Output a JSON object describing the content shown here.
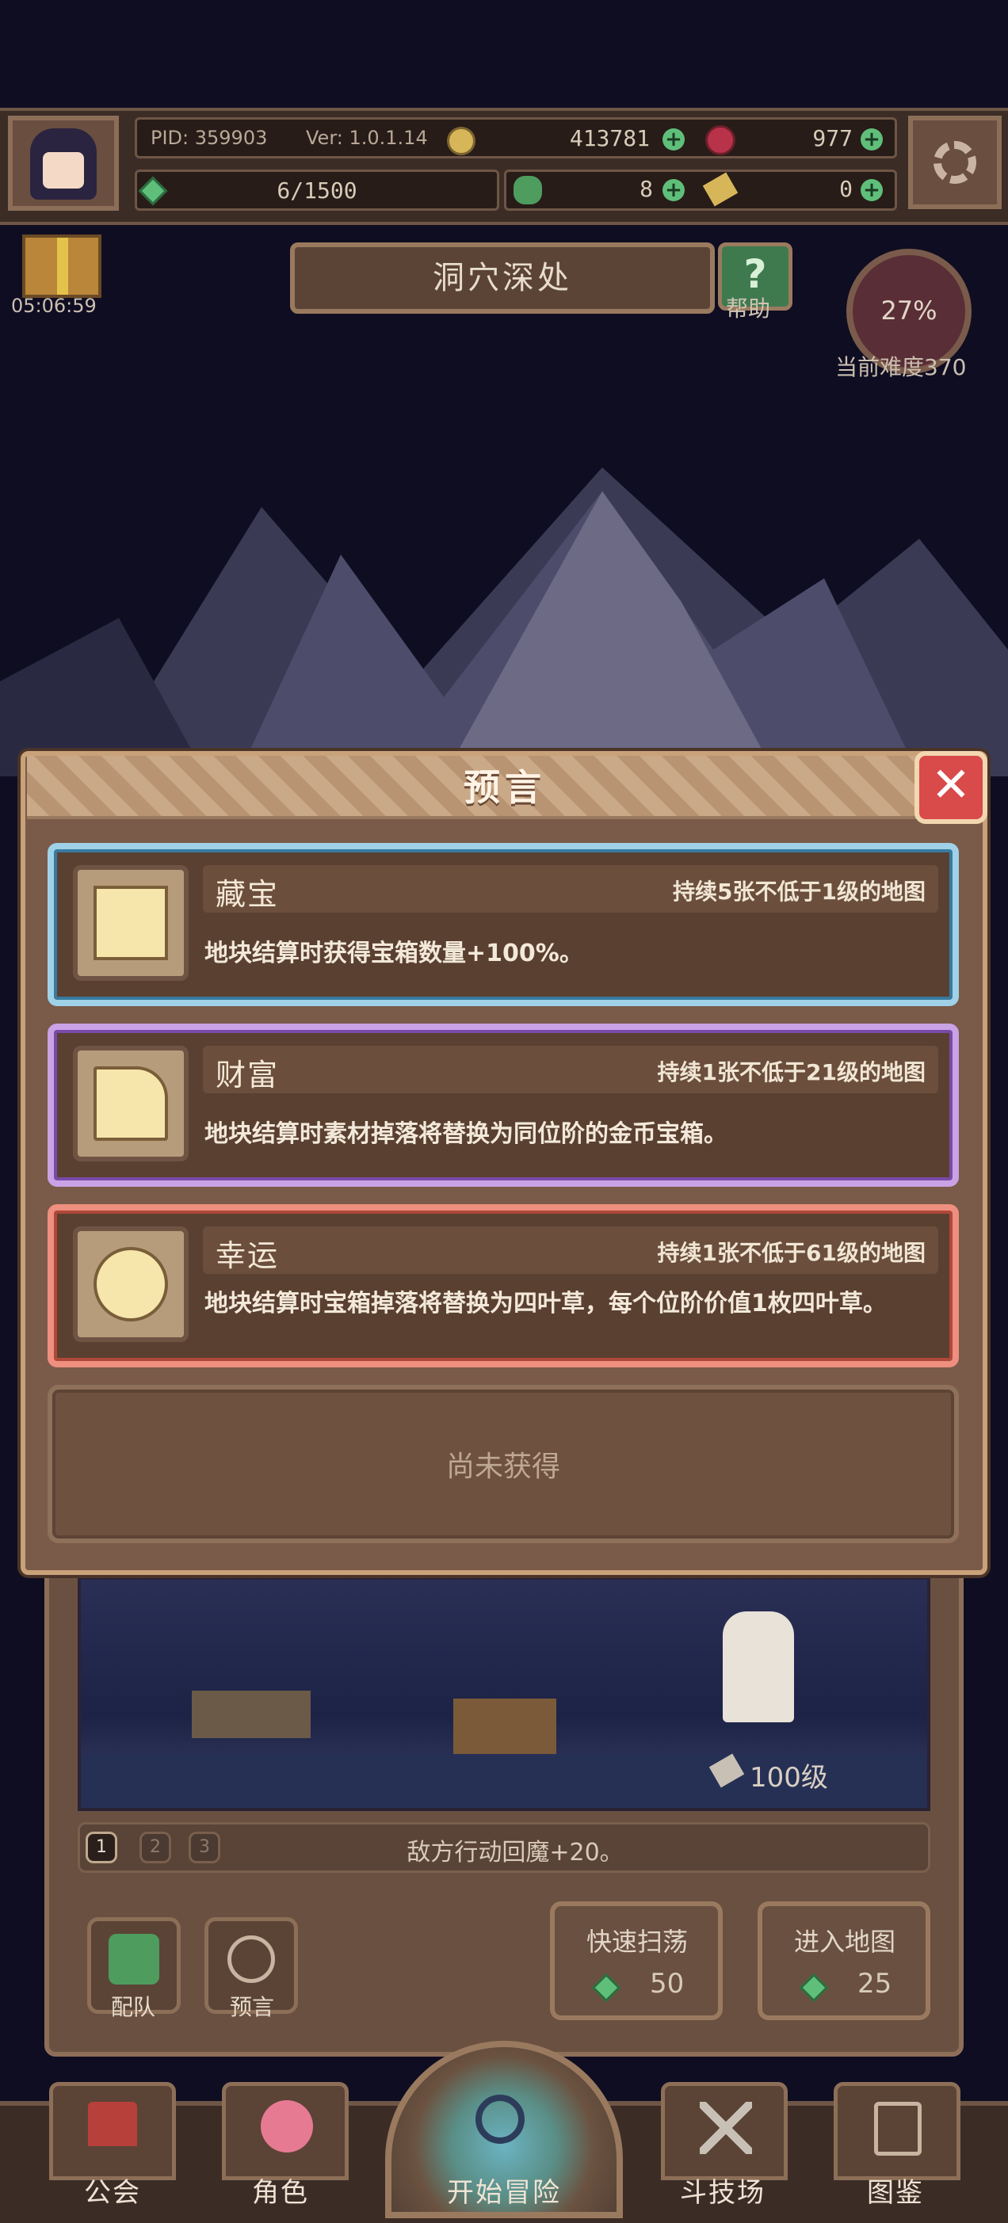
{
  "header": {
    "pid_label": "PID: 359903",
    "version_label": "Ver: 1.0.1.14",
    "gold": "413781",
    "ruby": "977",
    "energy": "6/1500",
    "clover": "8",
    "key": "0"
  },
  "area": {
    "timer": "05:06:59",
    "title": "洞穴深处",
    "help_label": "帮助",
    "difficulty_percent": "27%",
    "difficulty_label": "当前难度370"
  },
  "modal": {
    "title": "预言",
    "close_glyph": "✕",
    "cards": [
      {
        "name": "藏宝",
        "duration": "持续5张不低于1级的地图",
        "description": "地块结算时获得宝箱数量+100%。",
        "frame": "blue",
        "icon": "map-scroll-icon"
      },
      {
        "name": "财富",
        "duration": "持续1张不低于21级的地图",
        "description": "地块结算时素材掉落将替换为同位阶的金币宝箱。",
        "frame": "purple",
        "icon": "gold-stack-icon"
      },
      {
        "name": "幸运",
        "duration": "持续1张不低于61级的地图",
        "description": "地块结算时宝箱掉落将替换为四叶草，每个位阶价值1枚四叶草。",
        "frame": "red",
        "icon": "clover-icon"
      }
    ],
    "empty_slot_text": "尚未获得"
  },
  "game_panel": {
    "level": "100级",
    "stages": [
      "1",
      "2",
      "3"
    ],
    "effect_text": "敌方行动回魔+20。",
    "team_label": "配队",
    "prophecy_label": "预言",
    "quick_sweep_label": "快速扫荡",
    "quick_sweep_cost": "50",
    "enter_map_label": "进入地图",
    "enter_map_cost": "25"
  },
  "nav": {
    "items": [
      "公会",
      "角色",
      "开始冒险",
      "斗技场",
      "图鉴"
    ]
  },
  "colors": {
    "background": "#0f0d22",
    "panel": "#7a5a48",
    "card_blue": "#9fd2e8",
    "card_purple": "#c9a3e6",
    "card_red": "#ee8f7f",
    "close_red": "#d94a4a"
  }
}
